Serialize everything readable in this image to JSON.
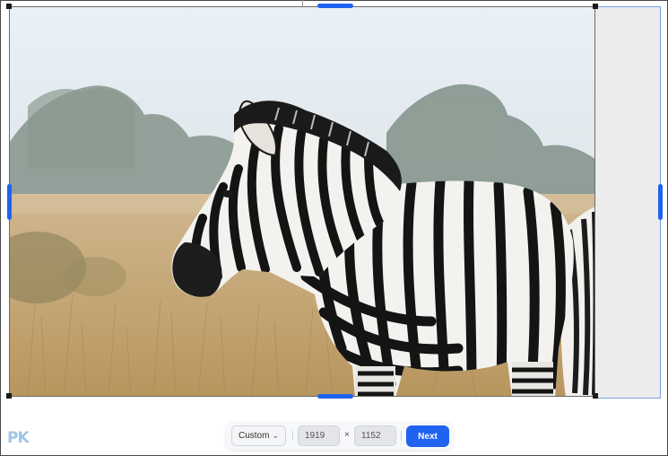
{
  "logo": {
    "text": "PK",
    "subtext": ""
  },
  "toolbar": {
    "ratio_label": "Custom",
    "ratio_caret": "⌄",
    "width_value": "1919",
    "height_value": "1152",
    "times_symbol": "×",
    "next_label": "Next"
  },
  "colors": {
    "accent": "#1f63f0",
    "pad_fill": "#ececec",
    "pad_border": "#7aa2e6"
  }
}
